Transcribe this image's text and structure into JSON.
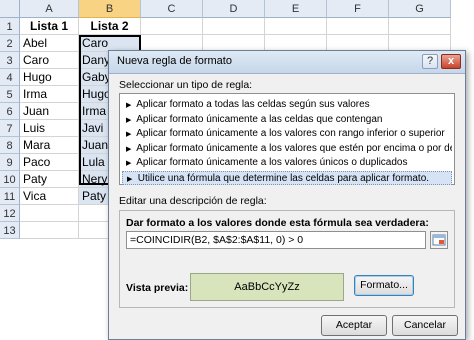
{
  "spreadsheet": {
    "columns": [
      "A",
      "B",
      "C",
      "D",
      "E",
      "F",
      "G"
    ],
    "rows": [
      "1",
      "2",
      "3",
      "4",
      "5",
      "6",
      "7",
      "8",
      "9",
      "10",
      "11",
      "12",
      "13"
    ],
    "headers": {
      "a1": "Lista 1",
      "b1": "Lista 2"
    },
    "lista1": [
      "Abel",
      "Caro",
      "Hugo",
      "Irma",
      "Juan",
      "Luis",
      "Mara",
      "Paco",
      "Paty",
      "Vica"
    ],
    "lista2": [
      "Caro",
      "Dany",
      "Gaby",
      "Hugo",
      "Irma",
      "Javi",
      "Juan",
      "Lula",
      "Nery",
      "Paty"
    ]
  },
  "dialog": {
    "title": "Nueva regla de formato",
    "help_label": "?",
    "close_label": "x",
    "select_rule_type_label": "Seleccionar un tipo de regla:",
    "rule_types": [
      "Aplicar formato a todas las celdas según sus valores",
      "Aplicar formato únicamente a las celdas que contengan",
      "Aplicar formato únicamente a los valores con rango inferior o superior",
      "Aplicar formato únicamente a los valores que estén por encima o por debajo del promedio",
      "Aplicar formato únicamente a los valores únicos o duplicados",
      "Utilice una fórmula que determine las celdas para aplicar formato."
    ],
    "selected_rule_index": 5,
    "edit_description_label": "Editar una descripción de regla:",
    "formula_label": "Dar formato a los valores donde esta fórmula sea verdadera:",
    "formula_value": "=COINCIDIR(B2, $A$2:$A$11, 0) > 0",
    "preview_label": "Vista previa:",
    "preview_text": "AaBbCcYyZz",
    "format_button": "Formato...",
    "ok_button": "Aceptar",
    "cancel_button": "Cancelar"
  }
}
